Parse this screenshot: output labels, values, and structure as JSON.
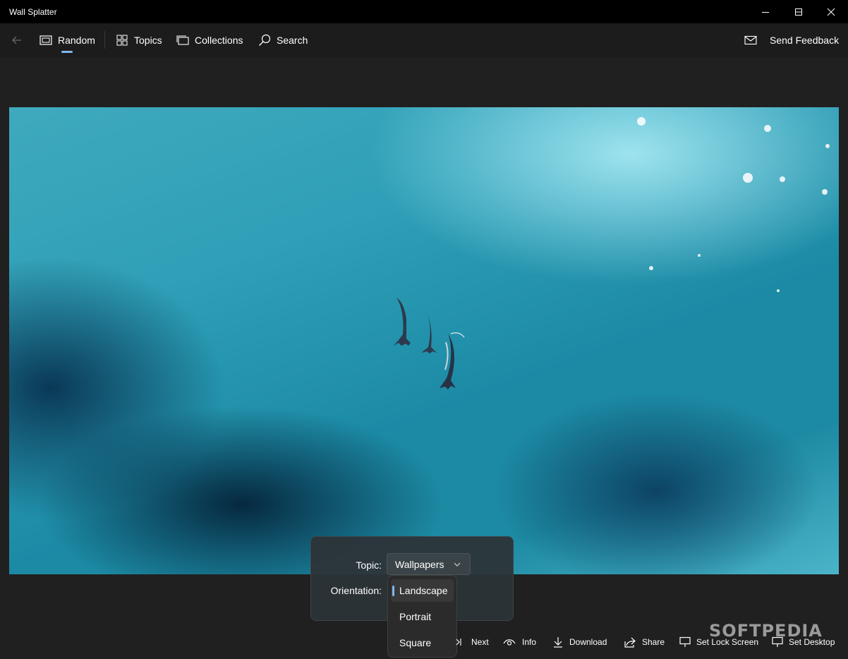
{
  "window": {
    "title": "Wall Splatter"
  },
  "nav": {
    "items": [
      {
        "label": "Random",
        "icon": "photo-frame-icon",
        "selected": true
      },
      {
        "label": "Topics",
        "icon": "grid-icon"
      },
      {
        "label": "Collections",
        "icon": "collections-icon"
      },
      {
        "label": "Search",
        "icon": "search-icon"
      }
    ],
    "feedback": "Send Feedback"
  },
  "filter": {
    "topic_label": "Topic:",
    "topic_value": "Wallpapers",
    "orientation_label": "Orientation:",
    "orientation_options": [
      "Landscape",
      "Portrait",
      "Square"
    ],
    "orientation_selected": "Landscape"
  },
  "commands": {
    "next": "Next",
    "info": "Info",
    "download": "Download",
    "share": "Share",
    "set_lock_screen": "Set Lock Screen",
    "set_desktop": "Set Desktop"
  },
  "watermark": "SOFTPEDIA",
  "colors": {
    "accent": "#7fb8ee",
    "background": "#202020",
    "titlebar": "#000000"
  }
}
